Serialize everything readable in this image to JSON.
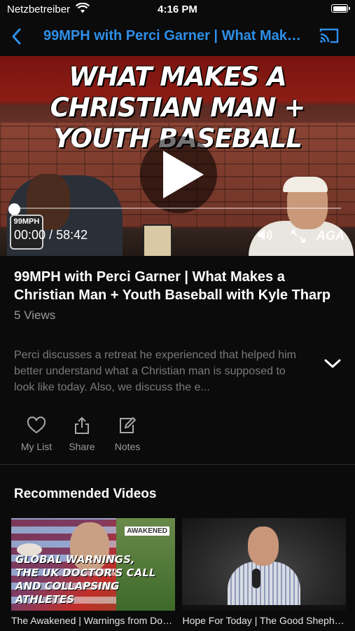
{
  "status_bar": {
    "carrier": "Netzbetreiber",
    "time": "4:16 PM"
  },
  "nav": {
    "title": "99MPH with Perci Garner | What Makes a Christian Man + Youth Baseball with Kyle Tharp",
    "accent": "#2e8fe8"
  },
  "player": {
    "headline": "WHAT MAKES A CHRISTIAN MAN + YOUTH BASEBALL",
    "logo": "99MPH",
    "current_time": "00:00",
    "separator": "/",
    "duration": "58:42",
    "brand": "AGA",
    "progress": 0
  },
  "video": {
    "title": "99MPH with Perci Garner | What Makes a Christian Man + Youth Baseball with Kyle Tharp",
    "views": "5 Views",
    "description": "Perci discusses a retreat he experienced that helped him better understand what a Christian man is supposed to look like today. Also, we discuss the e..."
  },
  "actions": [
    {
      "label": "My List",
      "icon": "heart-icon"
    },
    {
      "label": "Share",
      "icon": "share-icon"
    },
    {
      "label": "Notes",
      "icon": "edit-icon"
    }
  ],
  "recommended": {
    "heading": "Recommended Videos",
    "items": [
      {
        "title": "The Awakened | Warnings from Doctors",
        "thumb_tag": "AWAKENED",
        "thumb_caption": "GLOBAL WARNINGS,\nTHE UK DOCTOR'S CALL\nAND COLLAPSING ATHLETES"
      },
      {
        "title": "Hope For Today | The Good Shepherd",
        "thumb_tag": "",
        "thumb_caption": ""
      }
    ]
  }
}
